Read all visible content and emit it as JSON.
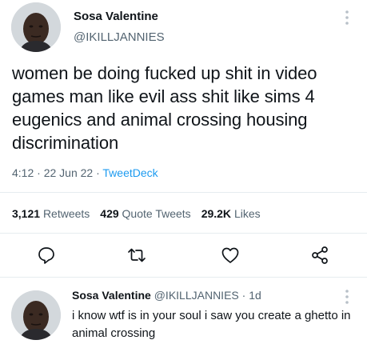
{
  "tweet": {
    "display_name": "Sosa Valentine",
    "handle": "@IKILLJANNIES",
    "text": "women be doing fucked up shit in video games man like evil ass shit like sims 4 eugenics and animal crossing housing discrimination",
    "time": "4:12",
    "sep1": " · ",
    "date": "22 Jun 22",
    "sep2": " · ",
    "source": "TweetDeck",
    "stats": {
      "retweets_count": "3,121",
      "retweets_label": "Retweets",
      "quotes_count": "429",
      "quotes_label": "Quote Tweets",
      "likes_count": "29.2K",
      "likes_label": "Likes"
    }
  },
  "reply": {
    "display_name": "Sosa Valentine",
    "handle": "@IKILLJANNIES",
    "sep": " · ",
    "age": "1d",
    "text": "i know wtf is in your soul i saw you create a ghetto in animal crossing"
  },
  "icons": {
    "reply": "comment-icon",
    "retweet": "retweet-icon",
    "like": "heart-icon",
    "share": "share-icon",
    "more": "more-vertical-icon"
  },
  "colors": {
    "text": "#0f1419",
    "secondary": "#536471",
    "link": "#1d9bf0",
    "divider": "#e6ecf0"
  }
}
